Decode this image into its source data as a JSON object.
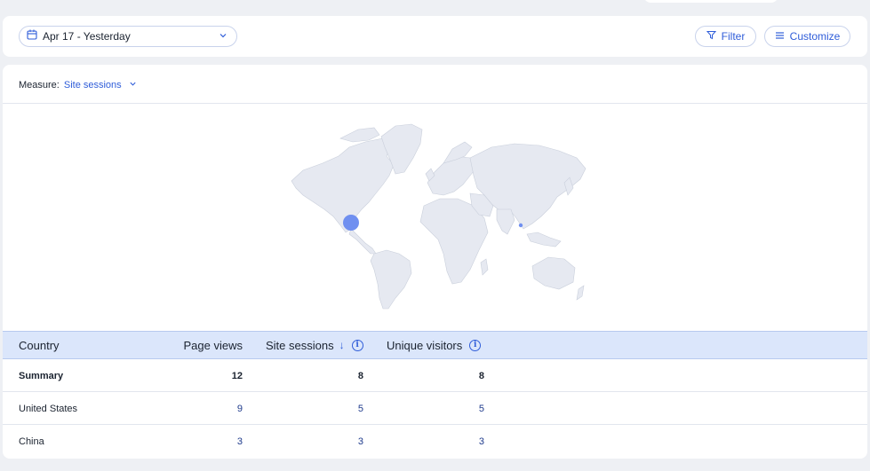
{
  "toolbar": {
    "date_range": "Apr 17 - Yesterday",
    "filter_label": "Filter",
    "customize_label": "Customize"
  },
  "measure": {
    "label": "Measure:",
    "value": "Site sessions"
  },
  "map": {
    "highlighted_countries": [
      "United States",
      "China"
    ],
    "bubble_color": "#6f8ff0"
  },
  "table": {
    "headers": {
      "country": "Country",
      "page_views": "Page views",
      "site_sessions": "Site sessions",
      "unique_visitors": "Unique visitors"
    },
    "sort_indicator": "↓",
    "summary": {
      "country": "Summary",
      "page_views": "12",
      "site_sessions": "8",
      "unique_visitors": "8"
    },
    "rows": [
      {
        "country": "United States",
        "page_views": "9",
        "site_sessions": "5",
        "unique_visitors": "5"
      },
      {
        "country": "China",
        "page_views": "3",
        "site_sessions": "3",
        "unique_visitors": "3"
      }
    ]
  },
  "colors": {
    "accent": "#2f5dd9",
    "header_bg": "#dbe6fb",
    "page_bg": "#eef0f4"
  },
  "icons": [
    "calendar-icon",
    "chevron-down-icon",
    "filter-icon",
    "customize-icon",
    "sort-arrow-icon",
    "info-icon"
  ]
}
